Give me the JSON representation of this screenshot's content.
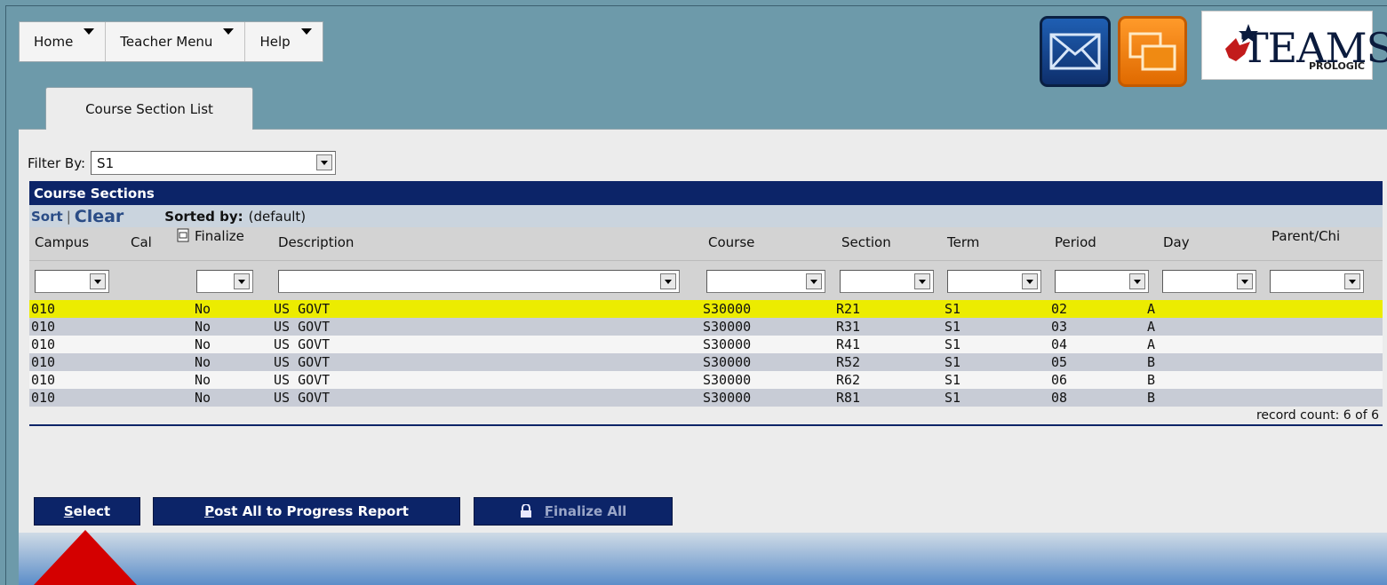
{
  "menu": [
    {
      "label": "Home"
    },
    {
      "label": "Teacher Menu"
    },
    {
      "label": "Help"
    }
  ],
  "logo": {
    "text": "TEAMS",
    "sub": "PROLOGIC"
  },
  "tab": {
    "label": "Course Section List"
  },
  "filter": {
    "label": "Filter By:",
    "value": "S1"
  },
  "grid": {
    "title": "Course Sections",
    "sort_label": "Sort",
    "clear_label": "Clear",
    "sorted_by_label": "Sorted by:",
    "sorted_by_value": "(default)",
    "columns": [
      "Campus",
      "Cal",
      "Finalize",
      "Description",
      "Course",
      "Section",
      "Term",
      "Period",
      "Day",
      "Parent/Chi"
    ],
    "rows": [
      {
        "campus": "010",
        "finalize": "No",
        "description": "US GOVT",
        "course": "S30000",
        "section": "R21",
        "term": "S1",
        "period": "02",
        "day": "A"
      },
      {
        "campus": "010",
        "finalize": "No",
        "description": "US GOVT",
        "course": "S30000",
        "section": "R31",
        "term": "S1",
        "period": "03",
        "day": "A"
      },
      {
        "campus": "010",
        "finalize": "No",
        "description": "US GOVT",
        "course": "S30000",
        "section": "R41",
        "term": "S1",
        "period": "04",
        "day": "A"
      },
      {
        "campus": "010",
        "finalize": "No",
        "description": "US GOVT",
        "course": "S30000",
        "section": "R52",
        "term": "S1",
        "period": "05",
        "day": "B"
      },
      {
        "campus": "010",
        "finalize": "No",
        "description": "US GOVT",
        "course": "S30000",
        "section": "R62",
        "term": "S1",
        "period": "06",
        "day": "B"
      },
      {
        "campus": "010",
        "finalize": "No",
        "description": "US GOVT",
        "course": "S30000",
        "section": "R81",
        "term": "S1",
        "period": "08",
        "day": "B"
      }
    ],
    "record_count": "record count: 6 of 6"
  },
  "buttons": {
    "select": {
      "first": "S",
      "rest": "elect"
    },
    "post_all": {
      "first": "P",
      "rest": "ost All to Progress Report"
    },
    "finalize_all": {
      "first": "F",
      "rest": "inalize All"
    }
  },
  "colors": {
    "highlight_row": "#ecec00",
    "grid_header": "#0c2468",
    "pointer_arrow": "#d40000"
  }
}
